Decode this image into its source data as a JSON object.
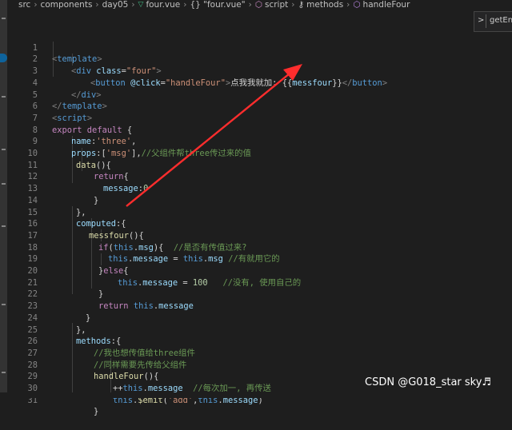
{
  "breadcrumb": {
    "seg1": "src",
    "seg2": "components",
    "seg3": "day05",
    "seg4": "four.vue",
    "seg5": "{} \"four.vue\"",
    "seg6": "script",
    "seg7": "methods",
    "seg8": "handleFour"
  },
  "hover_widget": {
    "text": "getEnc"
  },
  "lines": {
    "l1": {
      "n": "1",
      "a": "<",
      "b": "template",
      "c": ">"
    },
    "l2": {
      "n": "2",
      "a": "<",
      "b": "div",
      "c": " class",
      "d": "=",
      "e": "\"four\"",
      "f": ">"
    },
    "l3": {
      "n": "3",
      "a": "<",
      "b": "button",
      "c": " @click",
      "d": "=",
      "e": "\"handleFour\"",
      "f": ">",
      "g": "点我我就加: ",
      "h": "{{",
      "i": "messfour",
      "j": "}}",
      "k": "</",
      "l": "button",
      "m": ">"
    },
    "l4": {
      "n": "4",
      "a": "</",
      "b": "div",
      "c": ">"
    },
    "l5": {
      "n": "5",
      "a": "</",
      "b": "template",
      "c": ">"
    },
    "l6": {
      "n": "6",
      "a": "<",
      "b": "script",
      "c": ">"
    },
    "l7": {
      "n": "7",
      "a": "export",
      "b": " default",
      "c": " {"
    },
    "l8": {
      "n": "8",
      "a": "name",
      "b": ":",
      "c": "'three'",
      "d": ","
    },
    "l9": {
      "n": "9",
      "a": "props",
      "b": ":[",
      "c": "'msg'",
      "d": "],",
      "e": "//父组件帮three传过来的值"
    },
    "l10": {
      "n": "10",
      "a": "data",
      "b": "(){"
    },
    "l11": {
      "n": "11",
      "a": "return",
      "b": "{"
    },
    "l12": {
      "n": "12",
      "a": "message",
      "b": ":",
      "c": "0"
    },
    "l13": {
      "n": "13",
      "a": "}"
    },
    "l14": {
      "n": "14",
      "a": "},"
    },
    "l15": {
      "n": "15",
      "a": "computed",
      "b": ":{"
    },
    "l16": {
      "n": "16",
      "a": "messfour",
      "b": "(){"
    },
    "l17": {
      "n": "17",
      "a": "if",
      "b": "(",
      "c": "this",
      "d": ".",
      "e": "msg",
      "f": "){  ",
      "g": "//是否有传值过来?"
    },
    "l18": {
      "n": "18",
      "a": "this",
      "b": ".",
      "c": "message",
      "d": " = ",
      "e": "this",
      "f": ".",
      "g": "msg",
      "h": " ",
      "i": "//有就用它的"
    },
    "l19": {
      "n": "19",
      "a": "}",
      "b": "else",
      "c": "{"
    },
    "l20": {
      "n": "20",
      "a": "this",
      "b": ".",
      "c": "message",
      "d": " = ",
      "e": "100",
      "f": "   ",
      "g": "//没有, 使用自己的"
    },
    "l21": {
      "n": "21",
      "a": "}"
    },
    "l22": {
      "n": "22",
      "a": "return",
      "b": " ",
      "c": "this",
      "d": ".",
      "e": "message"
    },
    "l23": {
      "n": "23",
      "a": "}"
    },
    "l24": {
      "n": "24",
      "a": "},"
    },
    "l25": {
      "n": "25",
      "a": "methods",
      "b": ":{"
    },
    "l26": {
      "n": "26",
      "a": "//我也想传值给three组件"
    },
    "l27": {
      "n": "27",
      "a": "//同样需要先传给父组件"
    },
    "l28": {
      "n": "28",
      "a": "handleFour",
      "b": "(){"
    },
    "l29": {
      "n": "29",
      "a": "++",
      "b": "this",
      "c": ".",
      "d": "message",
      "e": "  ",
      "f": "//每次加一, 再传送"
    },
    "l30": {
      "n": "30",
      "a": "this",
      "b": ".",
      "c": "$emit",
      "d": "(",
      "e": "'add'",
      "f": ",",
      "g": "this",
      "h": ".",
      "i": "message",
      "j": ")"
    },
    "l31": {
      "n": "31",
      "a": "}"
    }
  },
  "watermark": {
    "text": "CSDN @G018_star sky♬"
  },
  "colors": {
    "background": "#1e1e1e",
    "tag": "#569cd6",
    "attribute": "#9cdcfe",
    "string": "#ce9178",
    "keyword_control": "#c586c0",
    "function": "#dcdcaa",
    "number": "#b5cea8",
    "comment": "#6a9955",
    "annotation_arrow": "#ff2d2d"
  },
  "icons": {
    "vue_file": "vue-logo-icon",
    "braces": "braces-icon",
    "script": "symbol-cube-icon",
    "methods": "wrench-icon",
    "handleFour": "method-cube-icon",
    "hover_chevron": "chevron-right-icon"
  }
}
